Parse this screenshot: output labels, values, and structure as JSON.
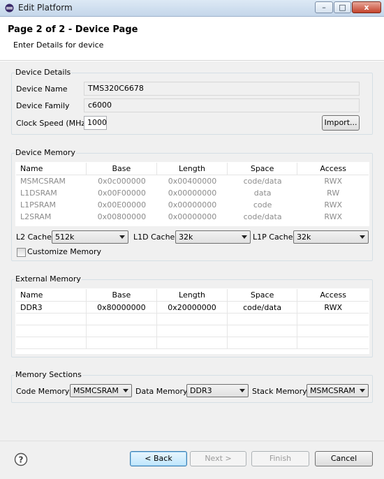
{
  "window": {
    "title": "Edit Platform",
    "minimize": "–",
    "maximize": "□",
    "close": "x"
  },
  "header": {
    "title": "Page 2 of 2 - Device Page",
    "subtitle": "Enter Details for device"
  },
  "device_details": {
    "group_title": "Device Details",
    "device_name_label": "Device Name",
    "device_name_value": "TMS320C6678",
    "device_family_label": "Device Family",
    "device_family_value": "c6000",
    "clock_speed_label": "Clock Speed (MHz)",
    "clock_speed_value": "1000",
    "import_button": "Import..."
  },
  "device_memory": {
    "group_title": "Device Memory",
    "columns": [
      "Name",
      "Base",
      "Length",
      "Space",
      "Access"
    ],
    "rows": [
      [
        "MSMCSRAM",
        "0x0c000000",
        "0x00400000",
        "code/data",
        "RWX"
      ],
      [
        "L1DSRAM",
        "0x00F00000",
        "0x00000000",
        "data",
        "RW"
      ],
      [
        "L1PSRAM",
        "0x00E00000",
        "0x00000000",
        "code",
        "RWX"
      ],
      [
        "L2SRAM",
        "0x00800000",
        "0x00000000",
        "code/data",
        "RWX"
      ]
    ],
    "l2_cache_label": "L2 Cache:",
    "l2_cache_value": "512k",
    "l1d_cache_label": "L1D Cache:",
    "l1d_cache_value": "32k",
    "l1p_cache_label": "L1P Cache:",
    "l1p_cache_value": "32k",
    "customize_label": "Customize Memory",
    "customize_checked": false
  },
  "external_memory": {
    "group_title": "External Memory",
    "columns": [
      "Name",
      "Base",
      "Length",
      "Space",
      "Access"
    ],
    "rows": [
      [
        "DDR3",
        "0x80000000",
        "0x20000000",
        "code/data",
        "RWX"
      ]
    ]
  },
  "memory_sections": {
    "group_title": "Memory Sections",
    "code_label": "Code Memory:",
    "code_value": "MSMCSRAM",
    "data_label": "Data Memory:",
    "data_value": "DDR3",
    "stack_label": "Stack Memory:",
    "stack_value": "MSMCSRAM"
  },
  "footer": {
    "help_icon": "question-icon",
    "back": "< Back",
    "next": "Next >",
    "finish": "Finish",
    "cancel": "Cancel"
  }
}
